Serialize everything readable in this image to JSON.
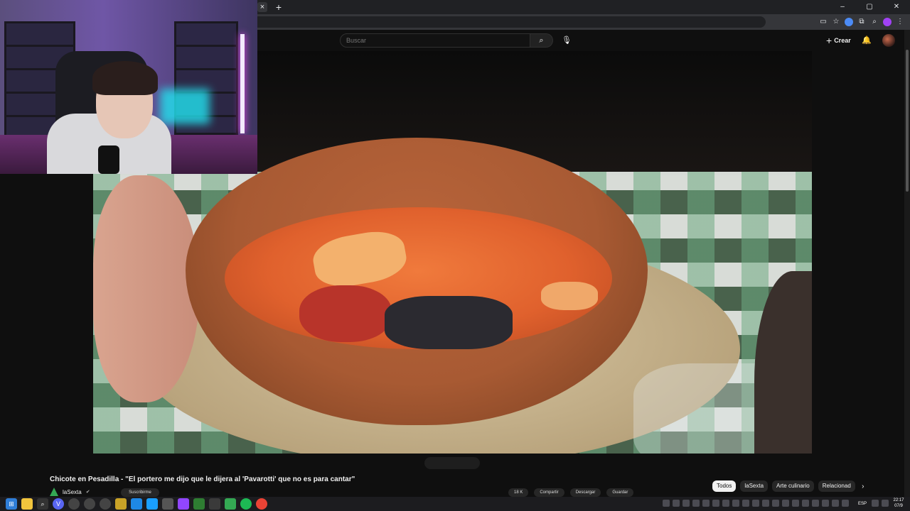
{
  "browser": {
    "tab_close_glyph": "×",
    "new_tab_glyph": "+",
    "window_controls": {
      "minimize": "–",
      "maximize": "▢",
      "close": "✕"
    },
    "extensions": [
      "cast-icon",
      "bookmark-star-icon",
      "extension-icon",
      "profile-icon"
    ]
  },
  "youtube": {
    "search": {
      "placeholder": "Buscar"
    },
    "create_label": "Crear",
    "video": {
      "title": "Chicote en Pesadilla - \"El portero me dijo que le dijera al 'Pavarotti' que no es para cantar\"",
      "channel": "laSexta",
      "subscribe_label": "Suscribirme",
      "actions": {
        "likes": "18 K",
        "share": "Compartir",
        "download": "Descargar",
        "save": "Guardar"
      }
    },
    "chips": [
      {
        "label": "Todos",
        "active": true
      },
      {
        "label": "laSexta",
        "active": false
      },
      {
        "label": "Arte culinario",
        "active": false
      },
      {
        "label": "Relacionad",
        "active": false
      }
    ]
  },
  "taskbar": {
    "language": "ESP",
    "time": "22:17",
    "date": "07/9"
  },
  "colors": {
    "youtube_background": "#0f0f0f",
    "chrome_dark": "#202124",
    "chip_active": "#f1f1f1",
    "channel_logo": "#34a853"
  }
}
